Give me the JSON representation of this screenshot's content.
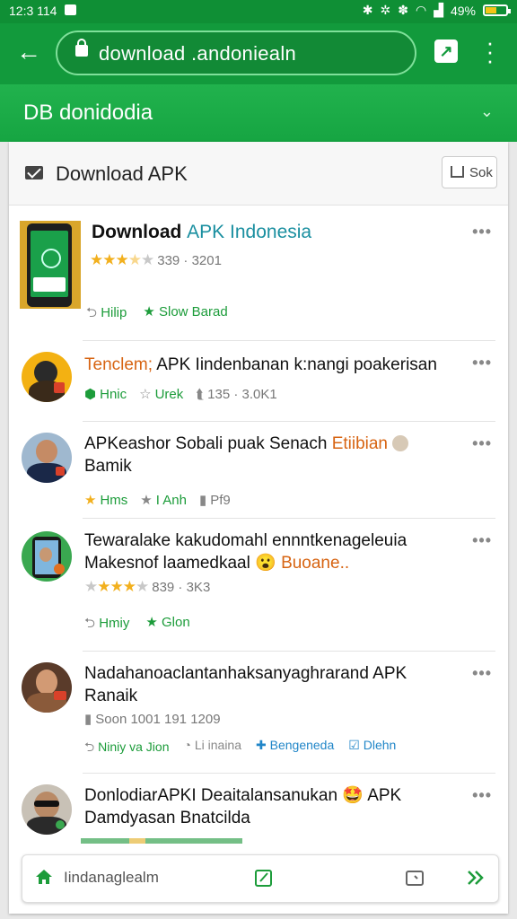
{
  "status_bar": {
    "time": "12:3 114",
    "battery": "49%",
    "battery_level": 0.49
  },
  "browser": {
    "url": "download .andoniealn"
  },
  "site_bar": {
    "title": "DB donidodia"
  },
  "card": {
    "header_title": "Download APK",
    "header_button": "Sok"
  },
  "items": [
    {
      "title_a": "Download ",
      "title_b": "APK Indonesia",
      "rating": "339 · 3201",
      "stars": 3.5,
      "action1": "Hilip",
      "action2": "Slow Barad"
    },
    {
      "title_a": "Tenclem;",
      "title_b": " APK Iindenbanan k:nangi poakerisan",
      "meta1": "Hnic",
      "meta2": "Urek",
      "meta3": "135 · 3.0K1"
    },
    {
      "title_a": "APKeashor Sobali puak Senach ",
      "title_b": "Etiibian",
      "title_c": "Bamik",
      "meta1": "Hms",
      "meta2": "I Anh",
      "meta3": "Pf9"
    },
    {
      "title_a": "Tewaralake kakudomahl ennntkenageleuia",
      "title_b": "Makesnof laamedkaal ",
      "title_c": "Buoane..",
      "rating": "839 · 3K3",
      "stars": 3.5,
      "action1": "Hmiy",
      "action2": "Glon"
    },
    {
      "title_a": "Nadahanoaclantanhaksanyaghrarand APK",
      "title_b": "Ranaik",
      "meta": "Soon 1001 191 1209",
      "action1": "Niniy va Jion",
      "action2": "Li inaina",
      "action3": "Bengeneda",
      "action4": "Dlehn"
    },
    {
      "title_a": "DonlodiarAPKI Deaitalansanukan ",
      "title_b": " APK",
      "title_c": "Damdyasan Bnatcilda"
    }
  ],
  "bottom_bar": {
    "text": "Iindanaglealm"
  },
  "colors": {
    "green_dark": "#0f8f35",
    "green": "#129a3c",
    "teal": "#1a8fa0",
    "orange": "#d76412"
  },
  "icons": [
    "back-arrow-icon",
    "lock-icon",
    "share-icon",
    "more-vert-icon",
    "chevron-down-icon",
    "mail-icon",
    "share-box-icon",
    "more-horiz-icon",
    "star-icon",
    "reply-icon",
    "home-icon",
    "edit-icon",
    "tab-icon",
    "forward-icon"
  ]
}
